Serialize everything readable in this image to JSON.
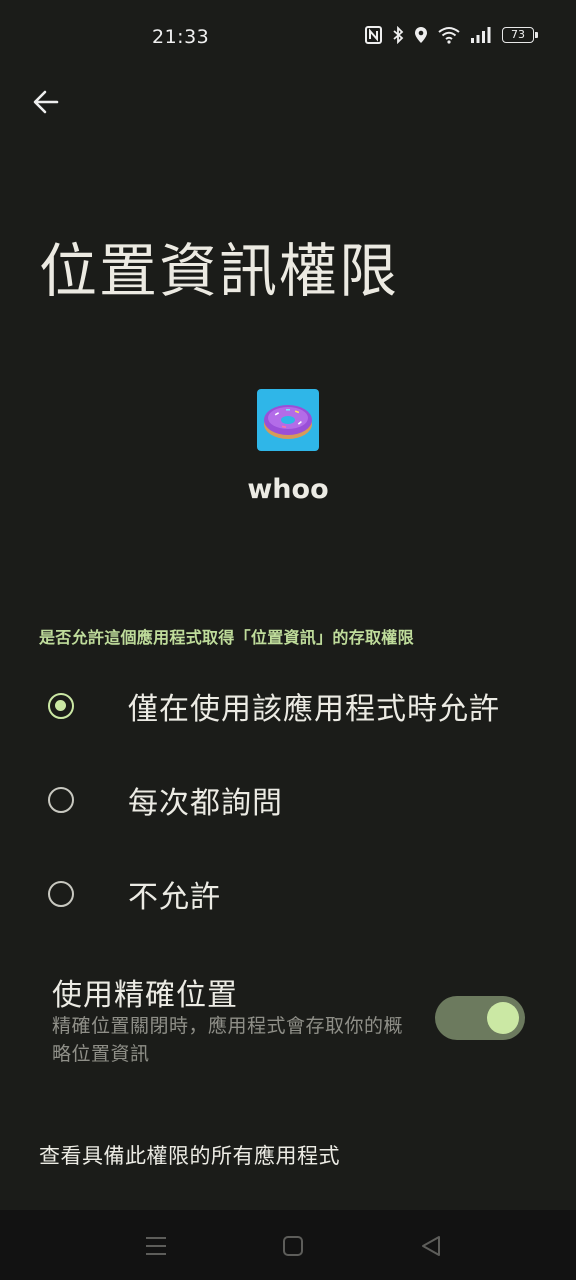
{
  "status_bar": {
    "time": "21:33",
    "battery": "73",
    "icons": [
      "nfc-icon",
      "bluetooth-icon",
      "location-icon",
      "wifi-icon",
      "signal-icon",
      "battery-icon"
    ]
  },
  "header": {
    "back_icon": "arrow-left-icon",
    "title": "位置資訊權限"
  },
  "app": {
    "name": "whoo",
    "icon": "donut-icon",
    "icon_bg": "#2fb6e8"
  },
  "permission": {
    "question": "是否允許這個應用程式取得「位置資訊」的存取權限",
    "options": [
      {
        "label": "僅在使用該應用程式時允許",
        "selected": true
      },
      {
        "label": "每次都詢問",
        "selected": false
      },
      {
        "label": "不允許",
        "selected": false
      }
    ]
  },
  "precise_location": {
    "title": "使用精確位置",
    "description": "精確位置關閉時，應用程式會存取你的概略位置資訊",
    "enabled": true
  },
  "footer_link": "查看具備此權限的所有應用程式",
  "nav_bar": {
    "icons": [
      "menu-icon",
      "home-icon",
      "back-triangle-icon"
    ]
  },
  "colors": {
    "background": "#1b1c19",
    "accent": "#cbe8a4",
    "toggle_track": "#6c7a5e",
    "section_header": "#bfdc9b"
  }
}
